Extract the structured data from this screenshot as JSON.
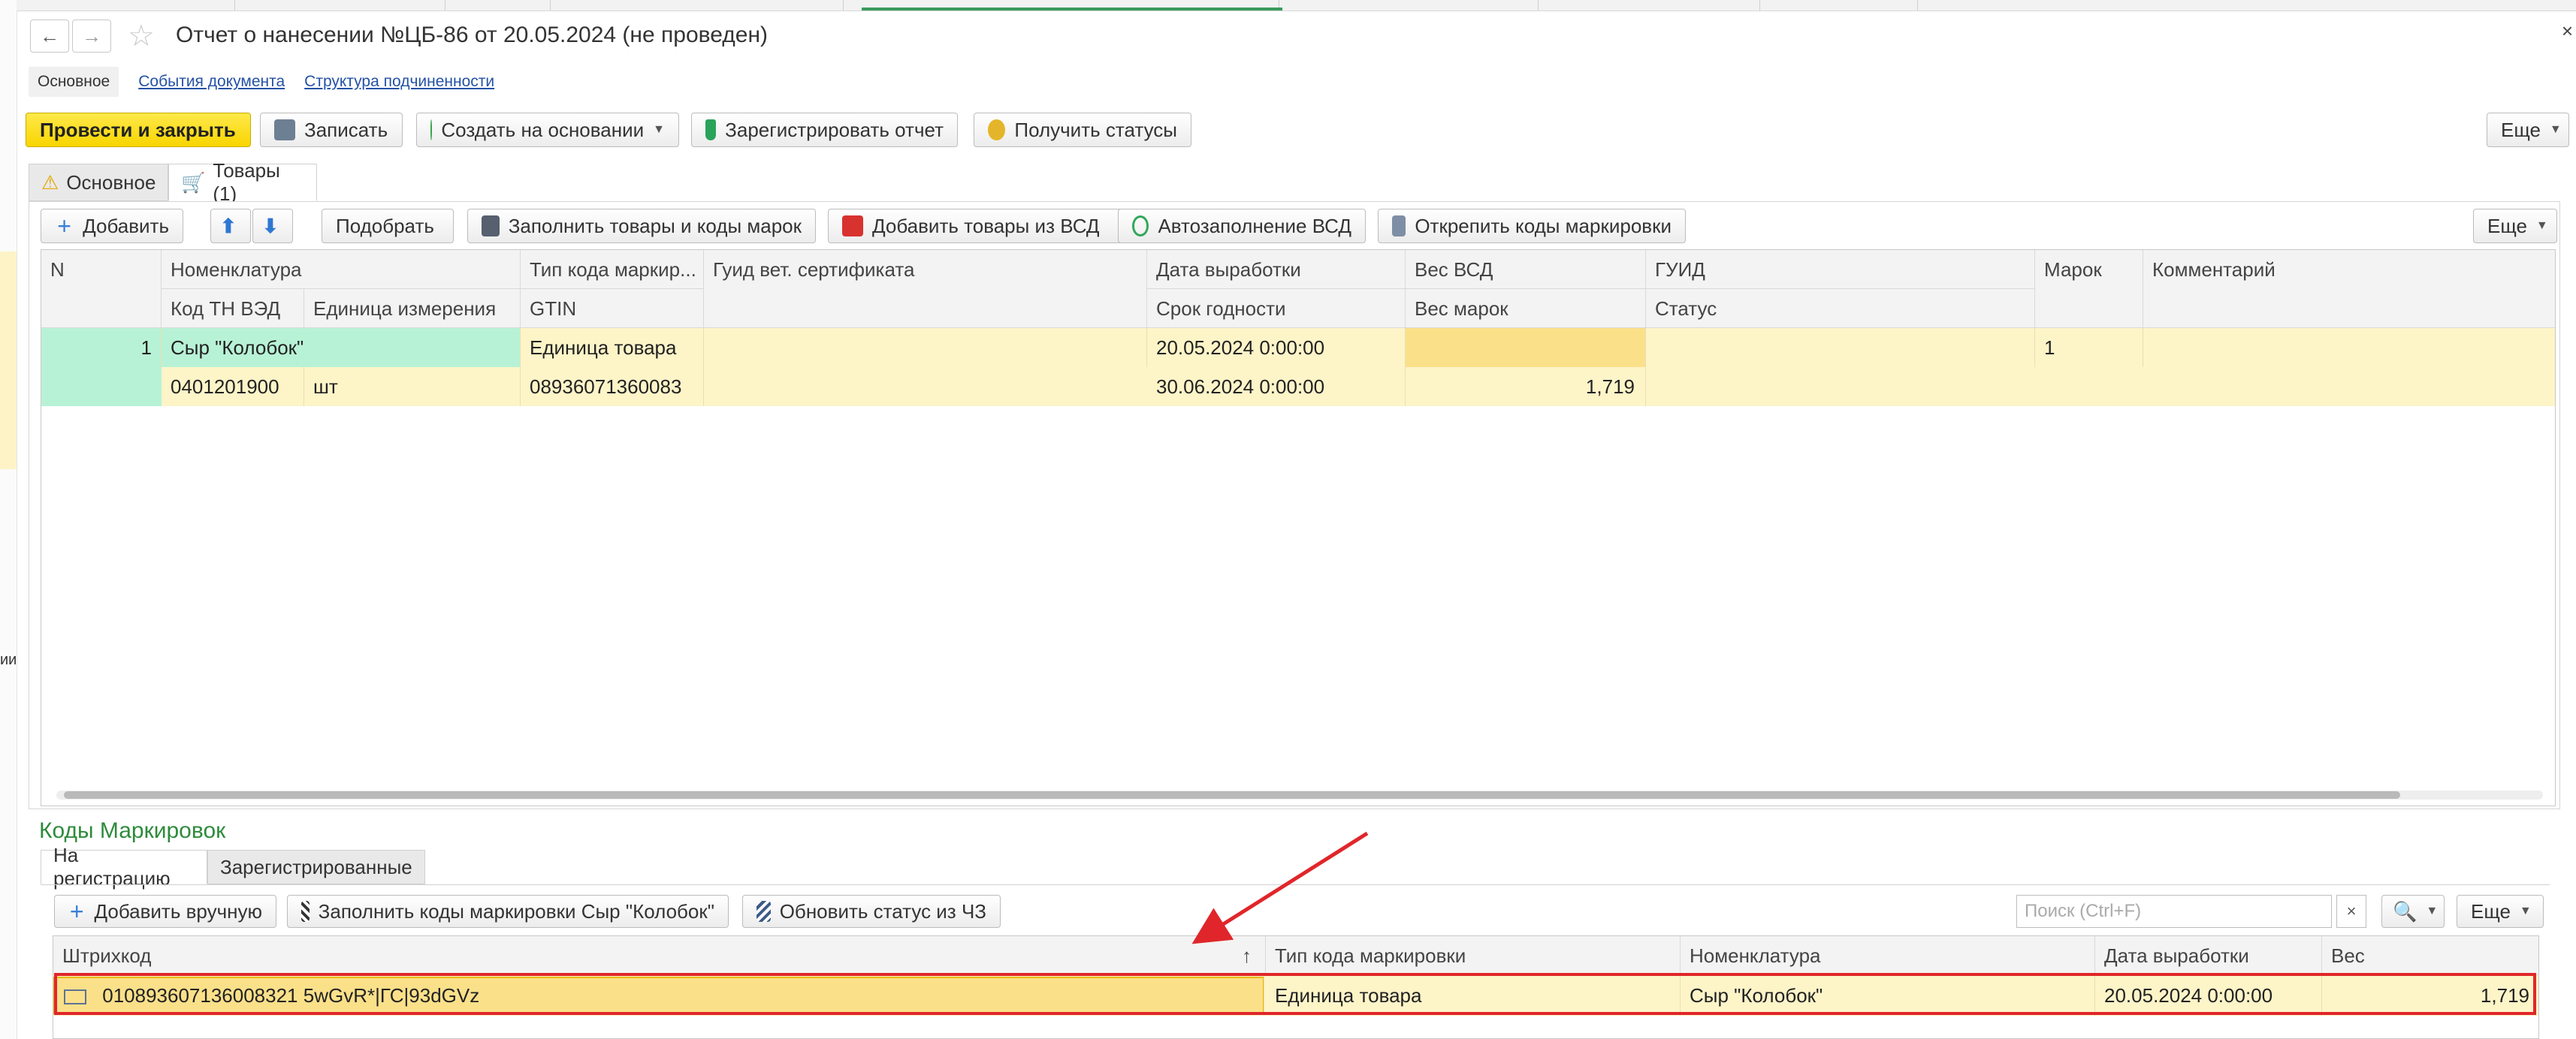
{
  "window": {
    "title": "Отчет о нанесении №ЦБ-86 от 20.05.2024 (не проведен)",
    "close": "×"
  },
  "sidebar": {
    "cut_text": "ии"
  },
  "sections": {
    "current": "Основное",
    "links": [
      "События документа",
      "Структура подчиненности"
    ]
  },
  "toolbar": {
    "post_close": "Провести и закрыть",
    "save": "Записать",
    "create_based": "Создать на основании",
    "register_report": "Зарегистрировать отчет",
    "get_statuses": "Получить статусы",
    "more": "Еще"
  },
  "tabs": [
    "Основное",
    "Товары (1)"
  ],
  "goods_toolbar": {
    "add": "Добавить",
    "pick": "Подобрать",
    "fill_goods_codes": "Заполнить товары и коды марок",
    "add_from_vsd": "Добавить товары из ВСД",
    "autofill_vsd": "Автозаполнение ВСД",
    "unpin_codes": "Открепить коды маркировки",
    "more": "Еще"
  },
  "goods_table": {
    "headers_top": [
      "N",
      "Номенклатура",
      "Тип кода маркир...",
      "Гуид вет. сертификата",
      "Дата выработки",
      "Вес ВСД",
      "ГУИД",
      "Марок",
      "Комментарий"
    ],
    "headers_bottom": [
      "Код ТН ВЭД",
      "Единица измерения",
      "GTIN",
      "Срок годности",
      "Вес марок",
      "Статус"
    ],
    "row": {
      "n": "1",
      "nomenclature": "Сыр \"Колобок\"",
      "code_type": "Единица товара",
      "production_date": "20.05.2024 0:00:00",
      "marks": "1",
      "tn_ved": "0401201900",
      "unit": "шт",
      "gtin": "08936071360083",
      "expiry": "30.06.2024 0:00:00",
      "marks_weight": "1,719"
    }
  },
  "codes": {
    "title": "Коды Маркировок",
    "tabs": [
      "На регистрацию",
      "Зарегистрированные"
    ],
    "add_manual": "Добавить вручную",
    "fill_codes": "Заполнить коды маркировки Сыр \"Колобок\"",
    "update_status": "Обновить статус из ЧЗ",
    "search_placeholder": "Поиск (Ctrl+F)",
    "search_clear": "×",
    "more": "Еще",
    "headers": [
      "Штрихкод",
      "Тип кода маркировки",
      "Номенклатура",
      "Дата выработки",
      "Вес"
    ],
    "sort_mark": "↑",
    "row": {
      "barcode": "010893607136008321 5wGvR*|ГС|93dGVz",
      "code_type": "Единица товара",
      "nomenclature": "Сыр \"Колобок\"",
      "production_date": "20.05.2024 0:00:00",
      "weight": "1,719"
    }
  }
}
